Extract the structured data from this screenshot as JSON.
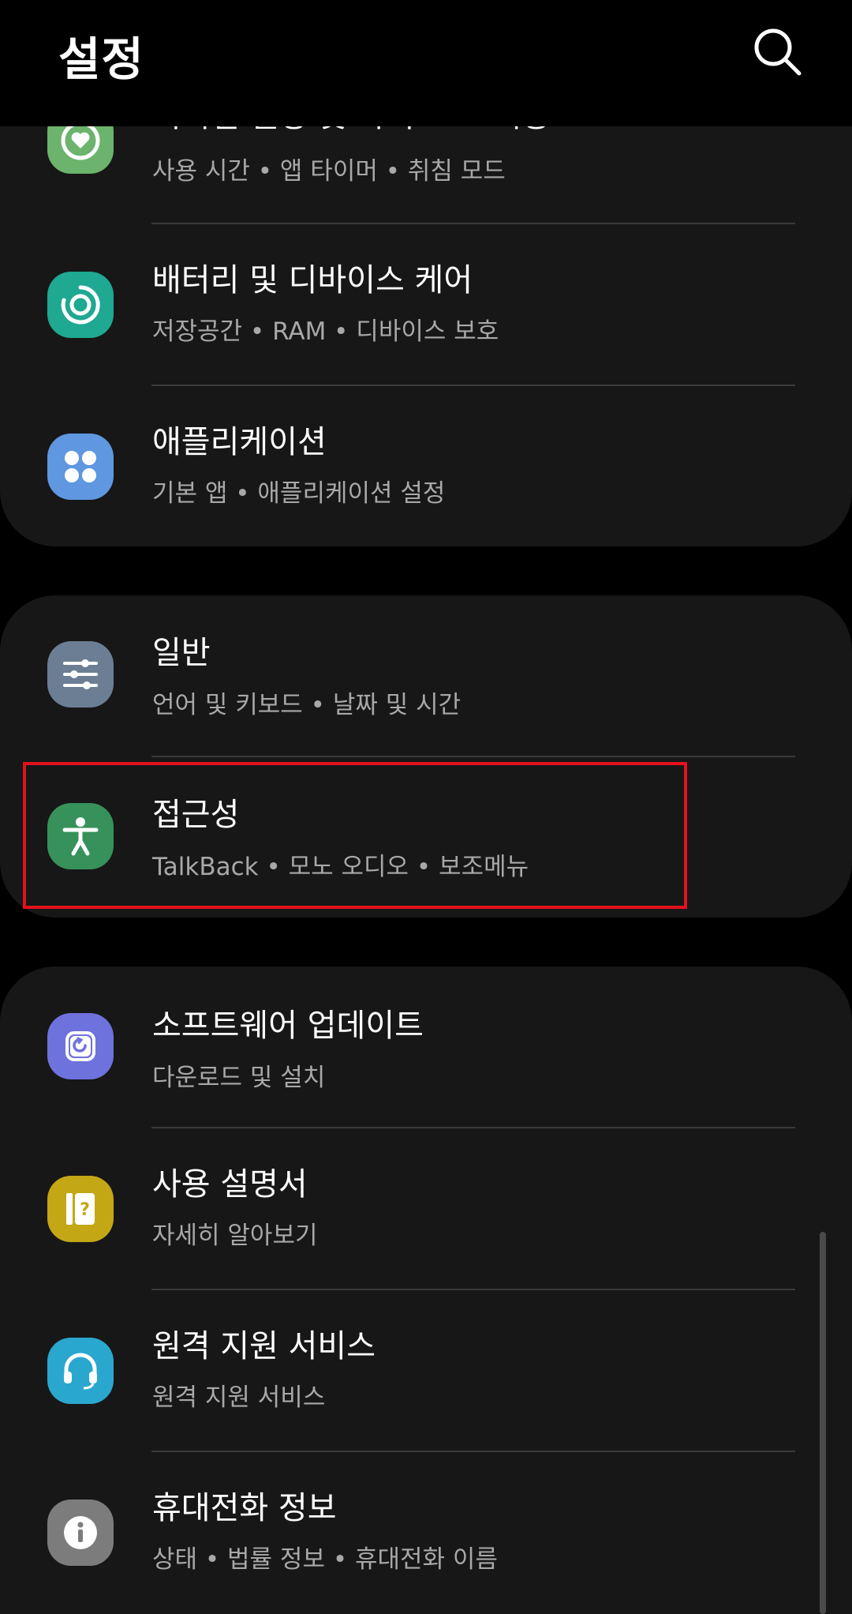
{
  "header": {
    "title": "설정",
    "search_icon": "search-icon"
  },
  "groups": [
    {
      "items": [
        {
          "title": "디지털 웰빙 및 자녀 보호 기능",
          "subtitle": "사용 시간 • 앱 타이머 • 취침 모드",
          "icon": "wellbeing-heart-icon",
          "icon_color": "#6cb36d"
        },
        {
          "title": "배터리 및 디바이스 케어",
          "subtitle": "저장공간 • RAM • 디바이스 보호",
          "icon": "device-care-icon",
          "icon_color": "#1fa892"
        },
        {
          "title": "애플리케이션",
          "subtitle": "기본 앱 • 애플리케이션 설정",
          "icon": "apps-grid-icon",
          "icon_color": "#5f97e0"
        }
      ]
    },
    {
      "items": [
        {
          "title": "일반",
          "subtitle": "언어 및 키보드 • 날짜 및 시간",
          "icon": "sliders-icon",
          "icon_color": "#6b7e93"
        },
        {
          "title": "접근성",
          "subtitle": "TalkBack • 모노 오디오 • 보조메뉴",
          "icon": "accessibility-person-icon",
          "icon_color": "#36925a"
        }
      ]
    },
    {
      "items": [
        {
          "title": "소프트웨어 업데이트",
          "subtitle": "다운로드 및 설치",
          "icon": "software-update-icon",
          "icon_color": "#6e72dc"
        },
        {
          "title": "사용 설명서",
          "subtitle": "자세히 알아보기",
          "icon": "user-manual-icon",
          "icon_color": "#c3a715"
        },
        {
          "title": "원격 지원 서비스",
          "subtitle": "원격 지원 서비스",
          "icon": "headset-icon",
          "icon_color": "#2aa7cf"
        },
        {
          "title": "휴대전화 정보",
          "subtitle": "상태 • 법률 정보 • 휴대전화 이름",
          "icon": "info-icon",
          "icon_color": "#7c7c7c"
        }
      ]
    }
  ],
  "colors": {
    "background": "#000000",
    "card": "#171717",
    "divider": "#3a3a3a",
    "subtitle": "#a8a8a8",
    "highlight": "#e3111c"
  }
}
